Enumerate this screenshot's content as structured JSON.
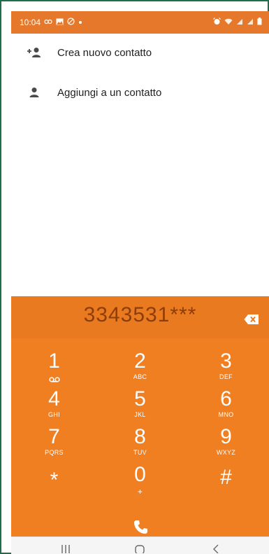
{
  "status_bar": {
    "time": "10:04",
    "left_icons": [
      "link-icon",
      "image-icon",
      "do-not-disturb-icon",
      "dot-icon"
    ],
    "right_icons": [
      "alarm-icon",
      "wifi-icon",
      "signal-icon",
      "signal-icon",
      "battery-icon"
    ],
    "color": "#e5782b"
  },
  "menu": {
    "items": [
      {
        "label": "Crea nuovo contatto",
        "icon": "add-person-icon"
      },
      {
        "label": "Aggiungi a un contatto",
        "icon": "person-icon"
      }
    ]
  },
  "dialpad": {
    "number": "3343531***",
    "accent": "#f07f22",
    "keys": [
      {
        "digit": "1",
        "letters": "",
        "icon": "voicemail-icon"
      },
      {
        "digit": "2",
        "letters": "ABC"
      },
      {
        "digit": "3",
        "letters": "DEF"
      },
      {
        "digit": "4",
        "letters": "GHI"
      },
      {
        "digit": "5",
        "letters": "JKL"
      },
      {
        "digit": "6",
        "letters": "MNO"
      },
      {
        "digit": "7",
        "letters": "PQRS"
      },
      {
        "digit": "8",
        "letters": "TUV"
      },
      {
        "digit": "9",
        "letters": "WXYZ"
      },
      {
        "digit": "*",
        "letters": ""
      },
      {
        "digit": "0",
        "letters": "+"
      },
      {
        "digit": "#",
        "letters": ""
      }
    ]
  }
}
